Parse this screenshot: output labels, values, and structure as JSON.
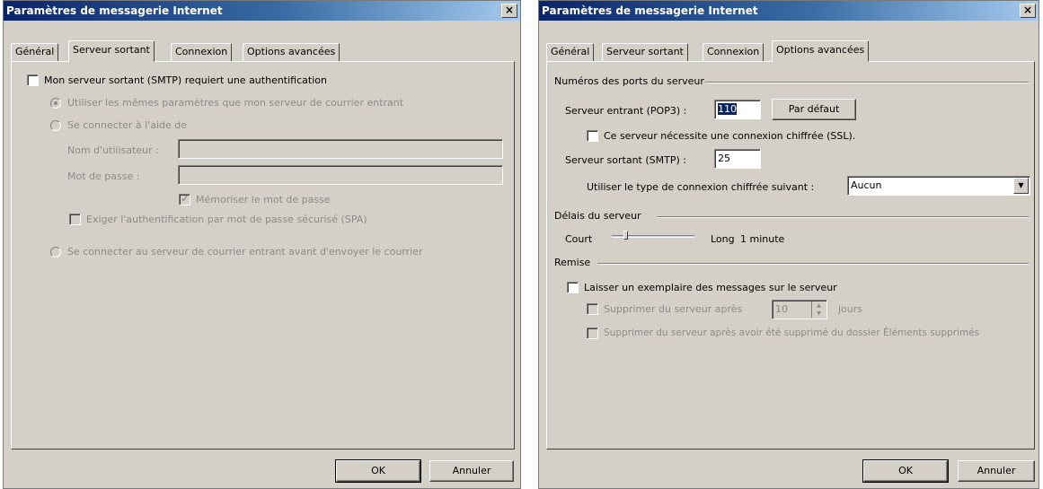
{
  "left_dialog": {
    "title": "Paramètres de messagerie Internet",
    "close_glyph": "×",
    "tabs": [
      "Général",
      "Serveur sortant",
      "Connexion",
      "Options avancées"
    ],
    "active_tab": "Serveur sortant",
    "auth_required_label": "Mon serveur sortant (SMTP) requiert une authentification",
    "use_same_settings_label": "Utiliser les mêmes paramètres que mon serveur de courrier entrant",
    "log_on_using_label": "Se connecter à l'aide de",
    "username_label": "Nom d'utilisateur :",
    "username_value": "",
    "password_label": "Mot de passe :",
    "password_value": "",
    "remember_password_label": "Mémoriser le mot de passe",
    "spa_label": "Exiger l'authentification par mot de passe sécurisé (SPA)",
    "log_on_incoming_label": "Se connecter au serveur de courrier entrant avant d'envoyer le courrier",
    "check_glyph": "✓",
    "ok_label": "OK",
    "cancel_label": "Annuler"
  },
  "right_dialog": {
    "title": "Paramètres de messagerie Internet",
    "close_glyph": "×",
    "tabs": [
      "Général",
      "Serveur sortant",
      "Connexion",
      "Options avancées"
    ],
    "active_tab": "Options avancées",
    "ports_group_label": "Numéros des ports du serveur",
    "incoming_label": "Serveur entrant (POP3) :",
    "incoming_value": "110",
    "default_button_label": "Par défaut",
    "ssl_label": "Ce serveur nécessite une connexion chiffrée (SSL).",
    "outgoing_label": "Serveur sortant (SMTP) :",
    "outgoing_value": "25",
    "encryption_label": "Utiliser le type de connexion chiffrée suivant :",
    "encryption_value": "Aucun",
    "combo_arrow_glyph": "▼",
    "timeouts_group_label": "Délais du serveur",
    "timeout_short_label": "Court",
    "timeout_long_label": "Long",
    "timeout_value": "1 minute",
    "timeout_level": 0.15,
    "delivery_group_label": "Remise",
    "leave_copy_label": "Laisser un exemplaire des messages sur le serveur",
    "remove_after_label": "Supprimer du serveur après",
    "remove_after_days": "10",
    "days_label": "jours",
    "spin_up_glyph": "▲",
    "spin_down_glyph": "▼",
    "remove_when_deleted_label": "Supprimer du serveur après avoir été supprimé du dossier Éléments supprimés",
    "ok_label": "OK",
    "cancel_label": "Annuler"
  }
}
